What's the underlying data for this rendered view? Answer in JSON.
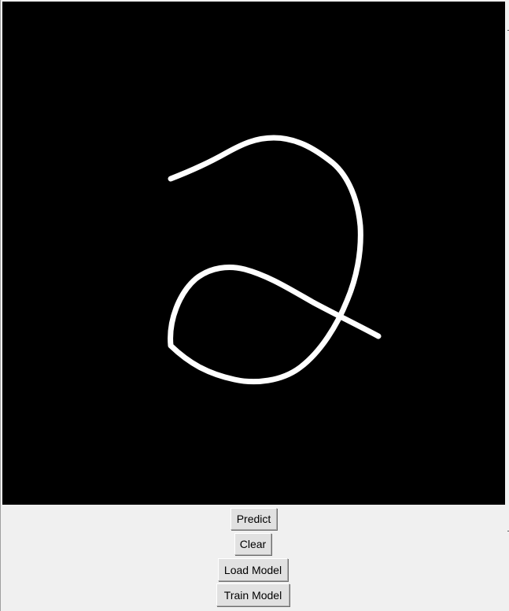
{
  "canvas": {
    "background": "#000000",
    "stroke_color": "#ffffff",
    "drawn_digit": "2"
  },
  "buttons": {
    "predict": "Predict",
    "clear": "Clear",
    "load_model": "Load Model",
    "train_model": "Train Model"
  },
  "colors": {
    "window_bg": "#f0f0f0",
    "button_bg": "#e1e1e1"
  }
}
